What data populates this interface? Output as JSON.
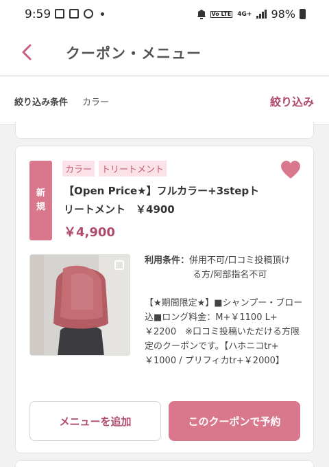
{
  "status_bar": {
    "time": "9:59",
    "network": "4G+",
    "battery": "98%",
    "icons": [
      "image-icon",
      "notification-square-icon",
      "sync-icon",
      "dot-icon",
      "alarm-icon",
      "volte-icon",
      "signal-icon",
      "battery-icon"
    ]
  },
  "header": {
    "title": "クーポン・メニュー",
    "back_icon": "chevron-left-icon"
  },
  "filter": {
    "label": "絞り込み条件",
    "value": "カラー",
    "button": "絞り込み"
  },
  "coupon": {
    "badge_line1": "新",
    "badge_line2": "規",
    "tags": [
      "カラー",
      "トリートメント"
    ],
    "title": "【Open Price★】フルカラー+3stepトリートメント　￥4900",
    "price": "￥4,900",
    "favorite_icon": "heart-icon",
    "conditions_label": "利用条件：",
    "conditions_line1": "併用不可/口コミ投稿頂け",
    "conditions_line2": "る方/阿部指名不可",
    "description": "【★期間限定★】■シャンプー・ブロー込■ロング料金：M+￥1100 L+￥2200　※口コミ投稿いただける方限定のクーポンです。【ハホニコtr+￥1000 / プリフィカtr+￥2000】",
    "add_menu_button": "メニューを追加",
    "reserve_button": "このクーポンで予約"
  },
  "colors": {
    "accent": "#b04a6a",
    "badge": "#d9778d",
    "tag_bg": "#fbe1e8",
    "heart": "#d9778d"
  }
}
